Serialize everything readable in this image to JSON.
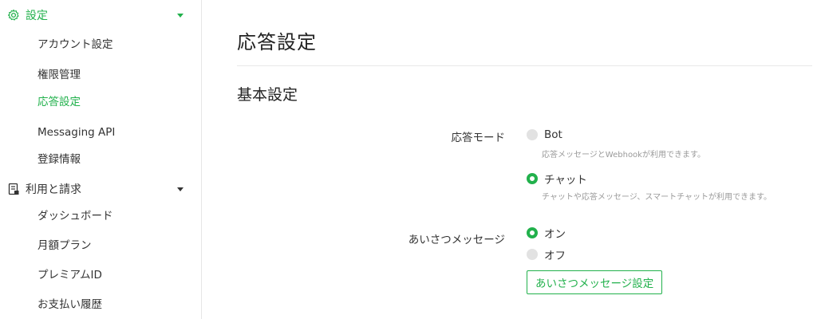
{
  "sidebar": {
    "settings_section": {
      "label": "設定",
      "icon": "gear-icon"
    },
    "settings_items": [
      {
        "label": "アカウント設定"
      },
      {
        "label": "権限管理"
      },
      {
        "label": "応答設定",
        "active": true
      },
      {
        "label": "Messaging API"
      },
      {
        "label": "登録情報"
      }
    ],
    "billing_section": {
      "label": "利用と請求",
      "icon": "billing-icon"
    },
    "billing_items": [
      {
        "label": "ダッシュボード"
      },
      {
        "label": "月額プラン"
      },
      {
        "label": "プレミアムID"
      },
      {
        "label": "お支払い履歴"
      }
    ]
  },
  "main": {
    "page_title": "応答設定",
    "section_title": "基本設定",
    "response_mode": {
      "label": "応答モード",
      "options": [
        {
          "label": "Bot",
          "description": "応答メッセージとWebhookが利用できます。",
          "selected": false
        },
        {
          "label": "チャット",
          "description": "チャットや応答メッセージ、スマートチャットが利用できます。",
          "selected": true
        }
      ]
    },
    "greeting": {
      "label": "あいさつメッセージ",
      "options": [
        {
          "label": "オン",
          "selected": true
        },
        {
          "label": "オフ",
          "selected": false
        }
      ],
      "settings_button": "あいさつメッセージ設定"
    }
  },
  "colors": {
    "accent": "#22b14c",
    "text": "#333333",
    "muted": "#9a9a9a"
  }
}
